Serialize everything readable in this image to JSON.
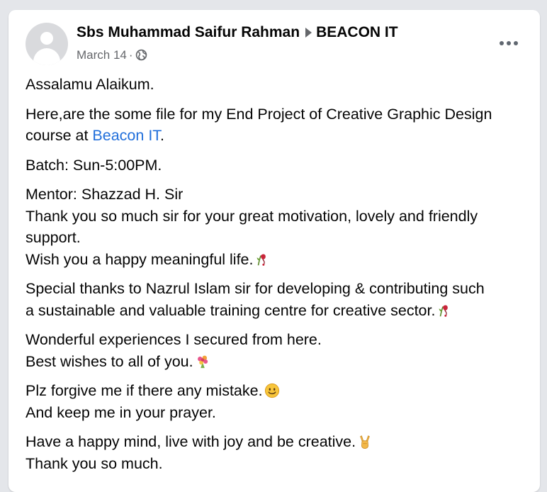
{
  "post": {
    "author": "Sbs Muhammad Saifur Rahman",
    "group": "BEACON IT",
    "date": "March 14",
    "privacy_icon": "globe-icon",
    "menu_icon": "more-options-icon"
  },
  "body": {
    "greeting": "Assalamu Alaikum.",
    "intro_line1": "Here,are the some file for my End Project of Creative Graphic Design",
    "intro_line2_before": "course at ",
    "intro_link": "Beacon IT",
    "intro_line2_after": ".",
    "batch": "Batch: Sun-5:00PM.",
    "mentor": "Mentor: Shazzad H. Sir",
    "thanks_line1": "Thank you so much sir for your great motivation, lovely and friendly",
    "thanks_line2": "support.",
    "wish": "Wish you a happy meaningful life.",
    "special_line1": "Special thanks to Nazrul Islam sir for developing &  contributing such",
    "special_line2": "a sustainable and valuable training centre for creative  sector.",
    "experience": "Wonderful experiences I secured  from here.",
    "best_wishes": "Best wishes to all of you.",
    "forgive": "Plz forgive me if there any mistake.",
    "prayer": "And keep me in your prayer.",
    "happy_mind": "Have a happy mind, live with joy and be creative.",
    "thank_you": "Thank you so much."
  },
  "emojis": [
    "wilted-rose-emoji",
    "wilted-rose-emoji",
    "bouquet-emoji",
    "smiling-face-emoji",
    "victory-hand-emoji"
  ],
  "colors": {
    "link": "#216fdb",
    "text": "#050505",
    "secondary_text": "#65676b",
    "background": "#e4e6ea",
    "card": "#ffffff"
  }
}
